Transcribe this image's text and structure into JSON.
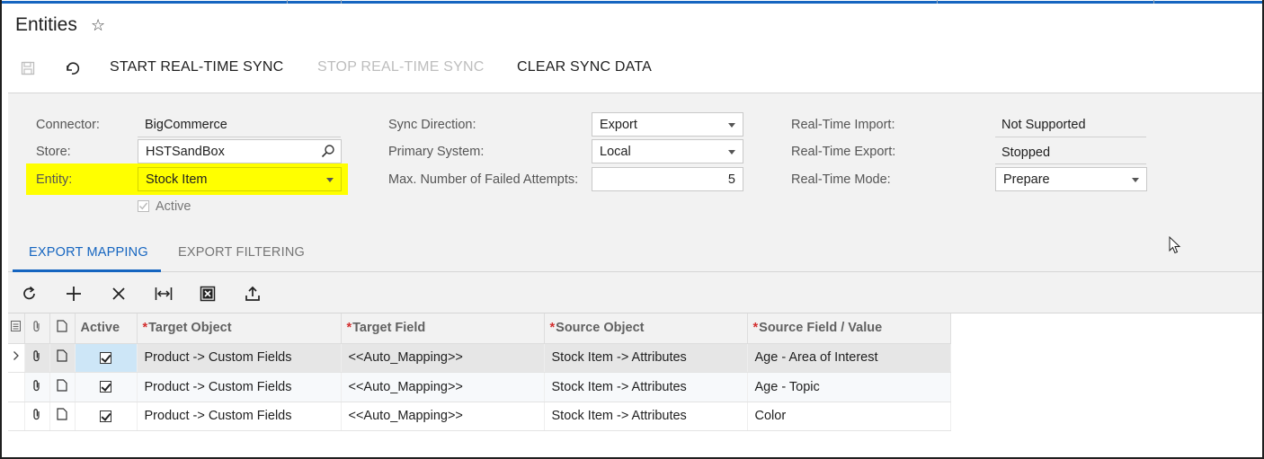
{
  "page": {
    "title": "Entities"
  },
  "toolbar": {
    "start_sync": "START REAL-TIME SYNC",
    "stop_sync": "STOP REAL-TIME SYNC",
    "clear_sync": "CLEAR SYNC DATA"
  },
  "summary": {
    "connector": {
      "label": "Connector:",
      "value": "BigCommerce"
    },
    "store": {
      "label": "Store:",
      "value": "HSTSandBox"
    },
    "entity": {
      "label": "Entity:",
      "value": "Stock Item"
    },
    "active": {
      "label": "Active",
      "checked": true
    },
    "sync_direction": {
      "label": "Sync Direction:",
      "value": "Export"
    },
    "primary_system": {
      "label": "Primary System:",
      "value": "Local"
    },
    "max_failed": {
      "label": "Max. Number of Failed Attempts:",
      "value": "5"
    },
    "rt_import": {
      "label": "Real-Time Import:",
      "value": "Not Supported"
    },
    "rt_export": {
      "label": "Real-Time Export:",
      "value": "Stopped"
    },
    "rt_mode": {
      "label": "Real-Time Mode:",
      "value": "Prepare"
    }
  },
  "tabs": [
    {
      "label": "EXPORT MAPPING",
      "active": true
    },
    {
      "label": "EXPORT FILTERING",
      "active": false
    }
  ],
  "grid": {
    "columns": {
      "active": "Active",
      "target_object": "Target Object",
      "target_field": "Target Field",
      "source_object": "Source Object",
      "source_field": "Source Field / Value"
    },
    "rows": [
      {
        "active": true,
        "target_object": "Product -> Custom Fields",
        "target_field": "<<Auto_Mapping>>",
        "source_object": "Stock Item -> Attributes",
        "source_field": "Age - Area of Interest"
      },
      {
        "active": true,
        "target_object": "Product -> Custom Fields",
        "target_field": "<<Auto_Mapping>>",
        "source_object": "Stock Item -> Attributes",
        "source_field": "Age - Topic"
      },
      {
        "active": true,
        "target_object": "Product -> Custom Fields",
        "target_field": "<<Auto_Mapping>>",
        "source_object": "Stock Item -> Attributes",
        "source_field": "Color"
      }
    ]
  },
  "colors": {
    "accent": "#1565c0",
    "highlight": "#ffff00",
    "required": "#d32f2f"
  },
  "icons": [
    "star-icon",
    "save-icon",
    "undo-icon",
    "search-icon",
    "dropdown-caret-icon",
    "refresh-icon",
    "add-icon",
    "delete-icon",
    "fit-width-icon",
    "excel-export-icon",
    "upload-icon",
    "notes-icon",
    "attachment-icon",
    "file-icon",
    "expand-row-icon",
    "mouse-cursor-icon"
  ]
}
